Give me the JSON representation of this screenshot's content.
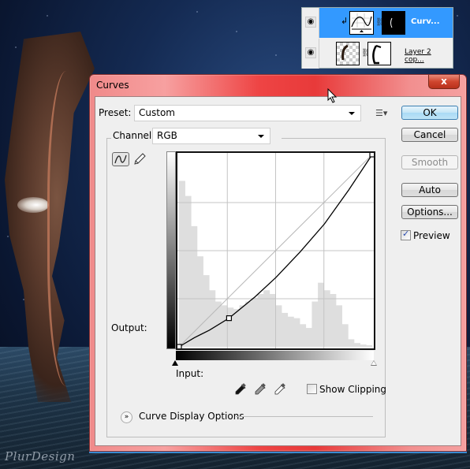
{
  "layers_panel": {
    "layers": [
      {
        "name": "Curv...",
        "type": "curves-adjustment",
        "selected": true,
        "visible": true,
        "clipped": true
      },
      {
        "name": "Layer 2 cop...",
        "type": "pixel-layer-with-mask",
        "selected": false,
        "visible": true,
        "clipped": false
      }
    ],
    "visibility_icon": "eye-icon",
    "link_icon": "chain-icon"
  },
  "dialog": {
    "title": "Curves",
    "close_label": "x",
    "preset": {
      "label": "Preset:",
      "value": "Custom"
    },
    "channel": {
      "label": "Channel:",
      "value": "RGB"
    },
    "buttons": {
      "ok": "OK",
      "cancel": "Cancel",
      "smooth": "Smooth",
      "auto": "Auto",
      "options": "Options..."
    },
    "preview": {
      "label": "Preview",
      "checked": true
    },
    "output_label": "Output:",
    "input_label": "Input:",
    "show_clipping": {
      "label": "Show Clipping",
      "checked": false
    },
    "curve_display_options": "Curve Display Options",
    "tools": [
      "curve-point-tool",
      "pencil-tool"
    ],
    "eyedroppers": [
      "black-point-eyedropper",
      "gray-point-eyedropper",
      "white-point-eyedropper"
    ],
    "accent_color": "#e83a3a",
    "default_button_color": "#a9daf5"
  },
  "watermark": "PlurDesign",
  "chart_data": {
    "type": "line",
    "title": "Curves",
    "xlabel": "Input:",
    "ylabel": "Output:",
    "xlim": [
      0,
      255
    ],
    "ylim": [
      0,
      255
    ],
    "grid": true,
    "grid_divisions": 4,
    "series": [
      {
        "name": "baseline",
        "x": [
          0,
          255
        ],
        "y": [
          0,
          255
        ]
      },
      {
        "name": "RGB curve",
        "control_points": [
          [
            0,
            0
          ],
          [
            66,
            38
          ],
          [
            255,
            255
          ]
        ],
        "x": [
          0,
          20,
          40,
          66,
          100,
          128,
          160,
          192,
          224,
          255
        ],
        "y": [
          0,
          12,
          22,
          38,
          66,
          92,
          126,
          163,
          208,
          255
        ]
      }
    ],
    "histogram": {
      "bins": [
        220,
        200,
        160,
        120,
        95,
        75,
        60,
        55,
        52,
        50,
        55,
        60,
        65,
        70,
        75,
        70,
        55,
        45,
        40,
        38,
        30,
        25,
        60,
        85,
        75,
        70,
        55,
        30,
        10,
        5,
        3,
        2
      ],
      "max": 255
    }
  }
}
